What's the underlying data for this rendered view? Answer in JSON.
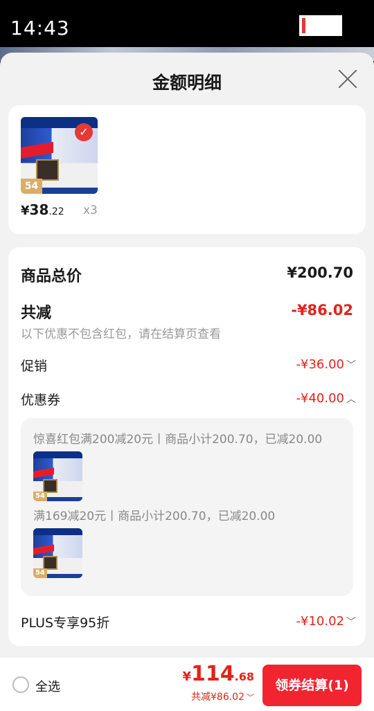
{
  "status_bar": {
    "time": "14:43"
  },
  "sheet": {
    "title": "金额明细",
    "close_icon": "close-icon"
  },
  "product": {
    "thumb_price_tag": "54",
    "price_symbol": "¥",
    "price_int": "38",
    "price_dec": ".22",
    "quantity": "x3"
  },
  "detail": {
    "total_label": "商品总价",
    "total_value": "¥200.70",
    "discount_label": "共减",
    "discount_value": "-¥86.02",
    "discount_note": "以下优惠不包含红包，请在结算页查看",
    "promo_label": "促销",
    "promo_value": "-¥36.00",
    "coupon_label": "优惠券",
    "coupon_value": "-¥40.00",
    "coupon_items": [
      {
        "text": "惊喜红包满200减20元丨商品小计200.70，已减20.00"
      },
      {
        "text": "满169减20元丨商品小计200.70，已减20.00"
      }
    ],
    "plus_label": "PLUS专享95折",
    "plus_value": "-¥10.02"
  },
  "footer": {
    "select_all": "全选",
    "final_symbol": "¥",
    "final_int": "114",
    "final_dec": ".68",
    "saved_text": "共减¥86.02",
    "pay_button": "领券结算(1)"
  },
  "colors": {
    "accent": "#e2231a",
    "button": "#f2242f"
  }
}
